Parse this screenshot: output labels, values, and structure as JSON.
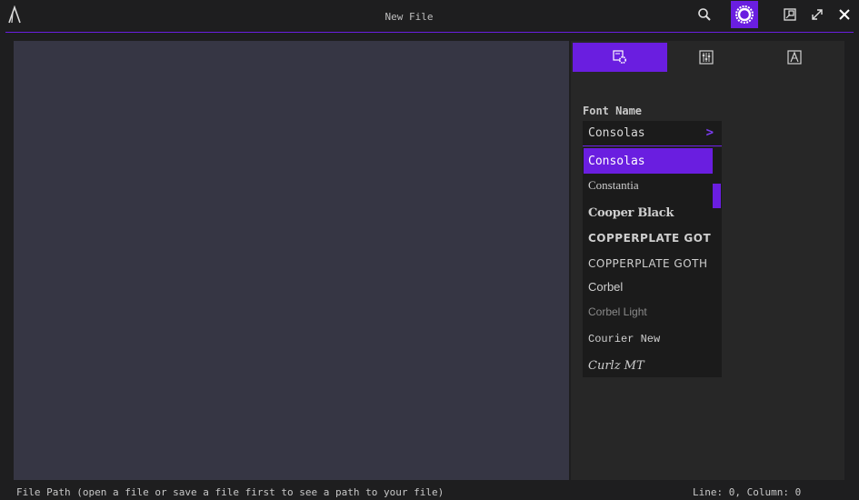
{
  "window": {
    "title": "New File"
  },
  "panel": {
    "tabs": [
      {
        "icon": "settings-icon",
        "active": true
      },
      {
        "icon": "sliders-icon",
        "active": false
      },
      {
        "icon": "font-icon",
        "active": false
      }
    ],
    "font_name_label": "Font Name",
    "font_name_value": "Consolas",
    "font_options": [
      "Consolas",
      "Constantia",
      "Cooper Black",
      "COPPERPLATE GOT",
      "COPPERPLATE GOTH",
      "Corbel",
      "Corbel Light",
      "Courier New",
      "Curlz MT"
    ],
    "selected_font": "Consolas"
  },
  "status": {
    "file_path": "File Path (open a file or save a file first to see a path to your file)",
    "position": "Line: 0, Column: 0"
  },
  "colors": {
    "accent": "#6a1ee0",
    "editor_bg": "#363644",
    "panel_bg": "#272727",
    "window_bg": "#1e1e1f"
  }
}
